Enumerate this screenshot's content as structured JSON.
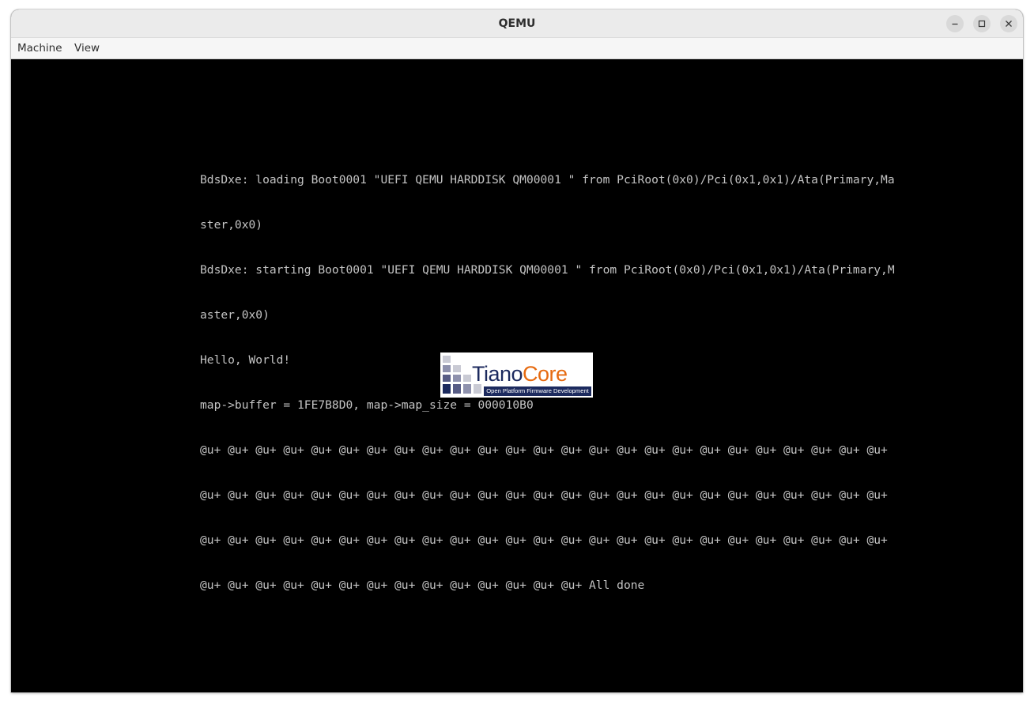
{
  "window": {
    "title": "QEMU"
  },
  "titlebar_buttons": {
    "minimize_icon": "minimize-icon",
    "maximize_icon": "maximize-icon",
    "close_icon": "close-icon"
  },
  "menu": {
    "machine": "Machine",
    "view": "View"
  },
  "console": {
    "lines": [
      "BdsDxe: loading Boot0001 \"UEFI QEMU HARDDISK QM00001 \" from PciRoot(0x0)/Pci(0x1,0x1)/Ata(Primary,Ma",
      "ster,0x0)",
      "BdsDxe: starting Boot0001 \"UEFI QEMU HARDDISK QM00001 \" from PciRoot(0x0)/Pci(0x1,0x1)/Ata(Primary,M",
      "aster,0x0)",
      "Hello, World!",
      "map->buffer = 1FE7B8D0, map->map_size = 000010B0",
      "@u+ @u+ @u+ @u+ @u+ @u+ @u+ @u+ @u+ @u+ @u+ @u+ @u+ @u+ @u+ @u+ @u+ @u+ @u+ @u+ @u+ @u+ @u+ @u+ @u+",
      "@u+ @u+ @u+ @u+ @u+ @u+ @u+ @u+ @u+ @u+ @u+ @u+ @u+ @u+ @u+ @u+ @u+ @u+ @u+ @u+ @u+ @u+ @u+ @u+ @u+",
      "@u+ @u+ @u+ @u+ @u+ @u+ @u+ @u+ @u+ @u+ @u+ @u+ @u+ @u+ @u+ @u+ @u+ @u+ @u+ @u+ @u+ @u+ @u+ @u+ @u+",
      "@u+ @u+ @u+ @u+ @u+ @u+ @u+ @u+ @u+ @u+ @u+ @u+ @u+ @u+ All done"
    ],
    "text_color": "#c4c4c4",
    "background": "#000000"
  },
  "logo": {
    "name_part1": "Tiano",
    "name_part2": "Core",
    "tagline": "Open Platform Firmware Development",
    "navy": "#1c2a5e",
    "orange": "#e66a10"
  }
}
